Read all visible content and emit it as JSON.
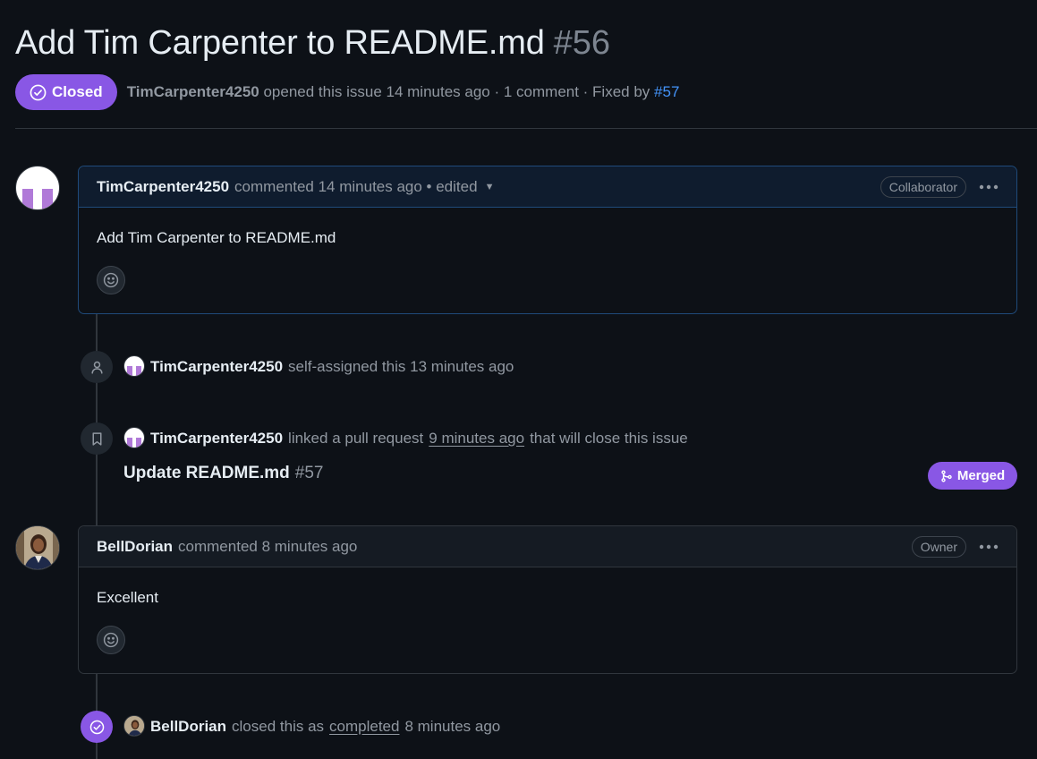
{
  "issue": {
    "title": "Add Tim Carpenter to README.md",
    "number": "#56",
    "state": "Closed",
    "opened_by": "TimCarpenter4250",
    "opened_text": "opened this issue 14 minutes ago · 1 comment · Fixed by",
    "fixed_by": "#57"
  },
  "comments": [
    {
      "author": "TimCarpenter4250",
      "meta": "commented 14 minutes ago • edited",
      "role": "Collaborator",
      "body": "Add Tim Carpenter to README.md"
    },
    {
      "author": "BellDorian",
      "meta": "commented 8 minutes ago",
      "role": "Owner",
      "body": "Excellent"
    }
  ],
  "events": {
    "assigned": {
      "author": "TimCarpenter4250",
      "text": "self-assigned this 13 minutes ago"
    },
    "linked": {
      "author": "TimCarpenter4250",
      "text_before": "linked a pull request",
      "time": "9 minutes ago",
      "text_after": "that will close this issue",
      "pr_title": "Update README.md",
      "pr_number": "#57",
      "pr_state": "Merged"
    },
    "closed": {
      "author": "BellDorian",
      "text_before": "closed this as",
      "reason": "completed",
      "time": "8 minutes ago"
    }
  },
  "colors": {
    "background": "#0d1117",
    "closed_purple": "#8957e5",
    "link_blue": "#4493f8",
    "muted": "#9198a1"
  },
  "icons": {
    "state": "check-circle-icon",
    "assign": "person-icon",
    "link": "bookmark-icon",
    "merged": "git-merge-icon",
    "reaction": "smiley-icon",
    "menu": "kebab-horizontal-icon",
    "closed_event": "check-circle-icon"
  }
}
